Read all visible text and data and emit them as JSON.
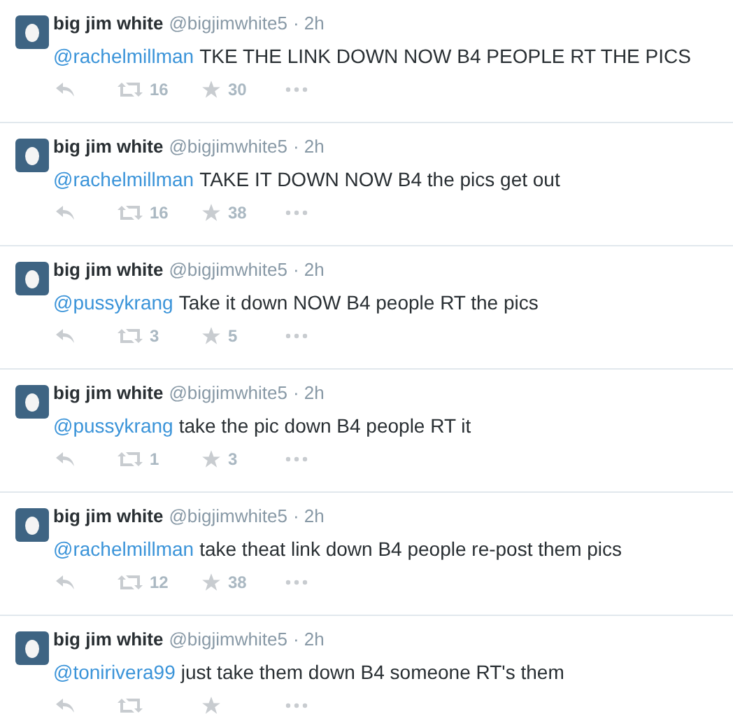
{
  "tweets": [
    {
      "name": "big jim white",
      "handle": "@bigjimwhite5",
      "time": "· 2h",
      "mention": "@rachelmillman",
      "text": "TKE THE LINK DOWN NOW B4 PEOPLE RT THE PICS",
      "retweets": "16",
      "favorites": "30"
    },
    {
      "name": "big jim white",
      "handle": "@bigjimwhite5",
      "time": "· 2h",
      "mention": "@rachelmillman",
      "text": "TAKE IT DOWN NOW B4 the pics get out",
      "retweets": "16",
      "favorites": "38"
    },
    {
      "name": "big jim white",
      "handle": "@bigjimwhite5",
      "time": "· 2h",
      "mention": "@pussykrang",
      "text": "Take it down NOW B4 people RT the pics",
      "retweets": "3",
      "favorites": "5"
    },
    {
      "name": "big jim white",
      "handle": "@bigjimwhite5",
      "time": "· 2h",
      "mention": "@pussykrang",
      "text": "take the pic down B4 people RT it",
      "retweets": "1",
      "favorites": "3"
    },
    {
      "name": "big jim white",
      "handle": "@bigjimwhite5",
      "time": "· 2h",
      "mention": "@rachelmillman",
      "text": "take theat link down B4 people re-post them pics",
      "retweets": "12",
      "favorites": "38"
    },
    {
      "name": "big jim white",
      "handle": "@bigjimwhite5",
      "time": "· 2h",
      "mention": "@tonirivera99",
      "text": "just take them down B4 someone RT's them"
    }
  ]
}
